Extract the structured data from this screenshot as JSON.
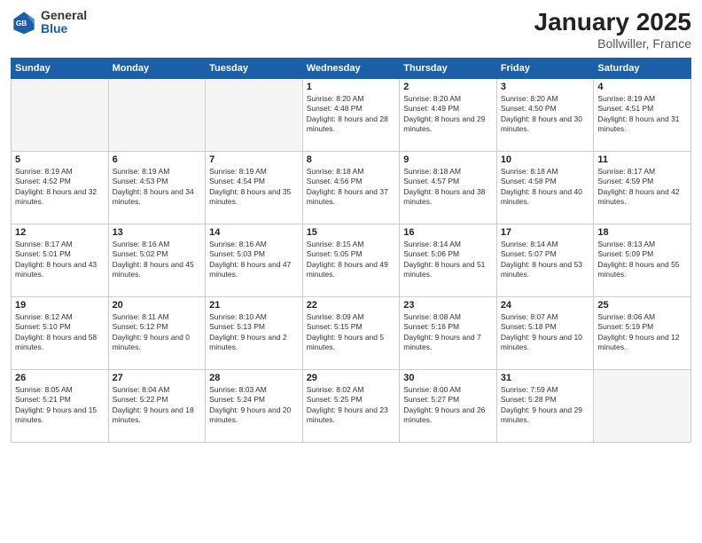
{
  "header": {
    "logo_general": "General",
    "logo_blue": "Blue",
    "month": "January 2025",
    "location": "Bollwiller, France"
  },
  "days_of_week": [
    "Sunday",
    "Monday",
    "Tuesday",
    "Wednesday",
    "Thursday",
    "Friday",
    "Saturday"
  ],
  "weeks": [
    [
      {
        "day": "",
        "empty": true
      },
      {
        "day": "",
        "empty": true
      },
      {
        "day": "",
        "empty": true
      },
      {
        "day": "1",
        "sunrise": "Sunrise: 8:20 AM",
        "sunset": "Sunset: 4:48 PM",
        "daylight": "Daylight: 8 hours and 28 minutes."
      },
      {
        "day": "2",
        "sunrise": "Sunrise: 8:20 AM",
        "sunset": "Sunset: 4:49 PM",
        "daylight": "Daylight: 8 hours and 29 minutes."
      },
      {
        "day": "3",
        "sunrise": "Sunrise: 8:20 AM",
        "sunset": "Sunset: 4:50 PM",
        "daylight": "Daylight: 8 hours and 30 minutes."
      },
      {
        "day": "4",
        "sunrise": "Sunrise: 8:19 AM",
        "sunset": "Sunset: 4:51 PM",
        "daylight": "Daylight: 8 hours and 31 minutes."
      }
    ],
    [
      {
        "day": "5",
        "sunrise": "Sunrise: 8:19 AM",
        "sunset": "Sunset: 4:52 PM",
        "daylight": "Daylight: 8 hours and 32 minutes."
      },
      {
        "day": "6",
        "sunrise": "Sunrise: 8:19 AM",
        "sunset": "Sunset: 4:53 PM",
        "daylight": "Daylight: 8 hours and 34 minutes."
      },
      {
        "day": "7",
        "sunrise": "Sunrise: 8:19 AM",
        "sunset": "Sunset: 4:54 PM",
        "daylight": "Daylight: 8 hours and 35 minutes."
      },
      {
        "day": "8",
        "sunrise": "Sunrise: 8:18 AM",
        "sunset": "Sunset: 4:56 PM",
        "daylight": "Daylight: 8 hours and 37 minutes."
      },
      {
        "day": "9",
        "sunrise": "Sunrise: 8:18 AM",
        "sunset": "Sunset: 4:57 PM",
        "daylight": "Daylight: 8 hours and 38 minutes."
      },
      {
        "day": "10",
        "sunrise": "Sunrise: 8:18 AM",
        "sunset": "Sunset: 4:58 PM",
        "daylight": "Daylight: 8 hours and 40 minutes."
      },
      {
        "day": "11",
        "sunrise": "Sunrise: 8:17 AM",
        "sunset": "Sunset: 4:59 PM",
        "daylight": "Daylight: 8 hours and 42 minutes."
      }
    ],
    [
      {
        "day": "12",
        "sunrise": "Sunrise: 8:17 AM",
        "sunset": "Sunset: 5:01 PM",
        "daylight": "Daylight: 8 hours and 43 minutes."
      },
      {
        "day": "13",
        "sunrise": "Sunrise: 8:16 AM",
        "sunset": "Sunset: 5:02 PM",
        "daylight": "Daylight: 8 hours and 45 minutes."
      },
      {
        "day": "14",
        "sunrise": "Sunrise: 8:16 AM",
        "sunset": "Sunset: 5:03 PM",
        "daylight": "Daylight: 8 hours and 47 minutes."
      },
      {
        "day": "15",
        "sunrise": "Sunrise: 8:15 AM",
        "sunset": "Sunset: 5:05 PM",
        "daylight": "Daylight: 8 hours and 49 minutes."
      },
      {
        "day": "16",
        "sunrise": "Sunrise: 8:14 AM",
        "sunset": "Sunset: 5:06 PM",
        "daylight": "Daylight: 8 hours and 51 minutes."
      },
      {
        "day": "17",
        "sunrise": "Sunrise: 8:14 AM",
        "sunset": "Sunset: 5:07 PM",
        "daylight": "Daylight: 8 hours and 53 minutes."
      },
      {
        "day": "18",
        "sunrise": "Sunrise: 8:13 AM",
        "sunset": "Sunset: 5:09 PM",
        "daylight": "Daylight: 8 hours and 55 minutes."
      }
    ],
    [
      {
        "day": "19",
        "sunrise": "Sunrise: 8:12 AM",
        "sunset": "Sunset: 5:10 PM",
        "daylight": "Daylight: 8 hours and 58 minutes."
      },
      {
        "day": "20",
        "sunrise": "Sunrise: 8:11 AM",
        "sunset": "Sunset: 5:12 PM",
        "daylight": "Daylight: 9 hours and 0 minutes."
      },
      {
        "day": "21",
        "sunrise": "Sunrise: 8:10 AM",
        "sunset": "Sunset: 5:13 PM",
        "daylight": "Daylight: 9 hours and 2 minutes."
      },
      {
        "day": "22",
        "sunrise": "Sunrise: 8:09 AM",
        "sunset": "Sunset: 5:15 PM",
        "daylight": "Daylight: 9 hours and 5 minutes."
      },
      {
        "day": "23",
        "sunrise": "Sunrise: 8:08 AM",
        "sunset": "Sunset: 5:16 PM",
        "daylight": "Daylight: 9 hours and 7 minutes."
      },
      {
        "day": "24",
        "sunrise": "Sunrise: 8:07 AM",
        "sunset": "Sunset: 5:18 PM",
        "daylight": "Daylight: 9 hours and 10 minutes."
      },
      {
        "day": "25",
        "sunrise": "Sunrise: 8:06 AM",
        "sunset": "Sunset: 5:19 PM",
        "daylight": "Daylight: 9 hours and 12 minutes."
      }
    ],
    [
      {
        "day": "26",
        "sunrise": "Sunrise: 8:05 AM",
        "sunset": "Sunset: 5:21 PM",
        "daylight": "Daylight: 9 hours and 15 minutes."
      },
      {
        "day": "27",
        "sunrise": "Sunrise: 8:04 AM",
        "sunset": "Sunset: 5:22 PM",
        "daylight": "Daylight: 9 hours and 18 minutes."
      },
      {
        "day": "28",
        "sunrise": "Sunrise: 8:03 AM",
        "sunset": "Sunset: 5:24 PM",
        "daylight": "Daylight: 9 hours and 20 minutes."
      },
      {
        "day": "29",
        "sunrise": "Sunrise: 8:02 AM",
        "sunset": "Sunset: 5:25 PM",
        "daylight": "Daylight: 9 hours and 23 minutes."
      },
      {
        "day": "30",
        "sunrise": "Sunrise: 8:00 AM",
        "sunset": "Sunset: 5:27 PM",
        "daylight": "Daylight: 9 hours and 26 minutes."
      },
      {
        "day": "31",
        "sunrise": "Sunrise: 7:59 AM",
        "sunset": "Sunset: 5:28 PM",
        "daylight": "Daylight: 9 hours and 29 minutes."
      },
      {
        "day": "",
        "empty": true
      }
    ]
  ]
}
